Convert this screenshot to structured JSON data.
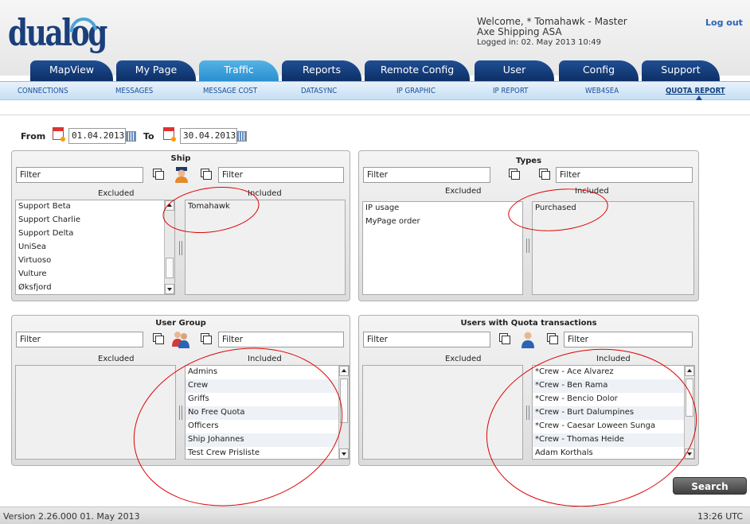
{
  "header": {
    "logo_text": "dualog",
    "welcome_line": "Welcome, * Tomahawk - Master",
    "company": "Axe Shipping ASA",
    "logged_in": "Logged in: 02. May 2013 10:49",
    "logout_label": "Log out"
  },
  "tabs": [
    "MapView",
    "My Page",
    "Traffic",
    "Reports",
    "Remote Config",
    "User",
    "Config",
    "Support"
  ],
  "active_tab": "Traffic",
  "subnav": [
    "CONNECTIONS",
    "MESSAGES",
    "MESSAGE COST",
    "DATASYNC",
    "IP GRAPHIC",
    "IP REPORT",
    "WEB4SEA",
    "QUOTA REPORT"
  ],
  "active_subnav": "QUOTA REPORT",
  "dates": {
    "from_label": "From",
    "from_value": "01.04.2013",
    "to_label": "To",
    "to_value": "30.04.2013"
  },
  "ship": {
    "title": "Ship",
    "filter_left": "Filter",
    "filter_right": "Filter",
    "excluded_label": "Excluded",
    "included_label": "Included",
    "excluded": [
      "Support Beta",
      "Support Charlie",
      "Support Delta",
      "UniSea",
      "Virtuoso",
      "Vulture",
      "Øksfjord"
    ],
    "included": [
      "Tomahawk"
    ]
  },
  "types": {
    "title": "Types",
    "filter_left": "Filter",
    "filter_right": "Filter",
    "excluded_label": "Excluded",
    "included_label": "Included",
    "excluded": [
      "IP usage",
      "MyPage order"
    ],
    "included": [
      "Purchased"
    ]
  },
  "user_group": {
    "title": "User Group",
    "filter_left": "Filter",
    "filter_right": "Filter",
    "excluded_label": "Excluded",
    "included_label": "Included",
    "excluded": [],
    "included": [
      "Admins",
      "Crew",
      "Griffs",
      "No Free Quota",
      "Officers",
      "Ship Johannes",
      "Test Crew Prisliste"
    ]
  },
  "users_quota": {
    "title": "Users with Quota transactions",
    "filter_left": "Filter",
    "filter_right": "Filter",
    "excluded_label": "Excluded",
    "included_label": "Included",
    "excluded": [],
    "included": [
      "*Crew - Ace Alvarez",
      "*Crew - Ben Rama",
      "*Crew - Bencio Dolor",
      "*Crew - Burt Dalumpines",
      "*Crew - Caesar Loween Sunga",
      "*Crew - Thomas Heide",
      "Adam Korthals"
    ]
  },
  "search_label": "Search",
  "footer": {
    "version": "Version 2.26.000 01. May 2013",
    "time": "13:26 UTC"
  },
  "colors": {
    "tab_dark": "#0d2f66",
    "tab_active": "#2a8fd0",
    "link": "#1b4f99",
    "annotation": "#dd0000"
  }
}
